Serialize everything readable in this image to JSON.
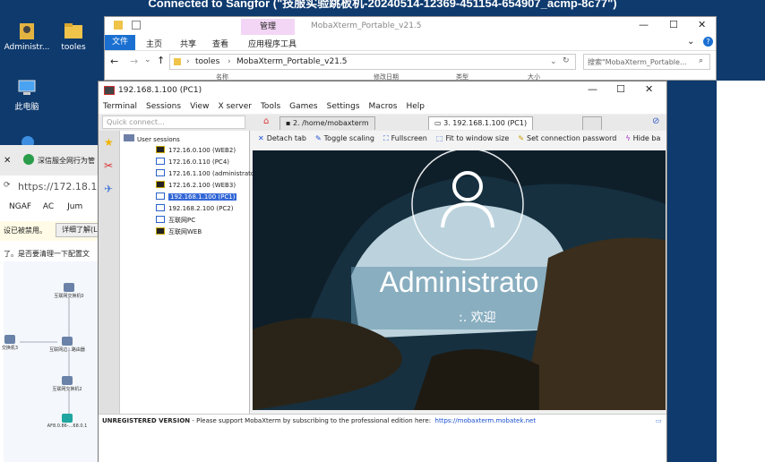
{
  "window": {
    "connection_title": "Connected to Sangfor (\"技服实验跳板机-20240514-12369-451154-654907_acmp-8c77\")"
  },
  "desktop": {
    "icons": [
      {
        "label": "Administr..."
      },
      {
        "label": "tooles"
      },
      {
        "label": "此电脑"
      }
    ]
  },
  "browser_bg": {
    "tab_title": "深信服全网行为管",
    "address": "https://172.18.1.2/",
    "bookmarks": [
      "NGAF",
      "AC",
      "Jum"
    ],
    "notice": "设已被禁用。",
    "details_button": "详细了解(L)",
    "prompt": "了。是否要清理一下配置文",
    "nodes": [
      "互联网交换机0",
      "交换机3",
      "互联网边...路由器",
      "互联网交换机2",
      "AF8.0.86-...68.0.1"
    ]
  },
  "explorer": {
    "ribbon_tab_context": "管理",
    "window_title": "MobaXterm_Portable_v21.5",
    "ribbon_tabs": [
      "文件",
      "主页",
      "共享",
      "查看",
      "应用程序工具"
    ],
    "path": [
      "tooles",
      "MobaXterm_Portable_v21.5"
    ],
    "search_placeholder": "搜索\"MobaXterm_Portable...",
    "column_headers": [
      "名称",
      "修改日期",
      "类型",
      "大小"
    ]
  },
  "moba": {
    "title": "192.168.1.100 (PC1)",
    "menu": [
      "Terminal",
      "Sessions",
      "View",
      "X server",
      "Tools",
      "Games",
      "Settings",
      "Macros",
      "Help"
    ],
    "quick_connect_placeholder": "Quick connect...",
    "tabs": [
      "2. /home/mobaxterm",
      "3. 192.168.1.100 (PC1)"
    ],
    "toolbar": [
      "Detach tab",
      "Toggle scaling",
      "Fullscreen",
      "Fit to window size",
      "Set connection password",
      "Hide ba"
    ],
    "sessions_root": "User sessions",
    "sessions": [
      {
        "label": "172.16.0.100 (WEB2)",
        "type": "term"
      },
      {
        "label": "172.16.0.110 (PC4)",
        "type": "rdp"
      },
      {
        "label": "172.16.1.100 (administrator)",
        "type": "rdp"
      },
      {
        "label": "172.16.2.100 (WEB3)",
        "type": "term"
      },
      {
        "label": "192.168.1.100 (PC1)",
        "type": "rdp",
        "selected": true
      },
      {
        "label": "192.168.2.100 (PC2)",
        "type": "rdp"
      },
      {
        "label": "互联网PC",
        "type": "rdp"
      },
      {
        "label": "互联网WEB",
        "type": "term"
      }
    ],
    "remote_user": "Administrato",
    "remote_welcome": "欢迎",
    "status_unregistered": "UNREGISTERED VERSION",
    "status_message": "  -  Please support MobaXterm by subscribing to the professional edition here:",
    "status_link": "https://mobaxterm.mobatek.net"
  },
  "colors": {
    "accent": "#1a6fd1",
    "selected": "#3367d6",
    "ribbon_context": "#f3d6f5"
  }
}
